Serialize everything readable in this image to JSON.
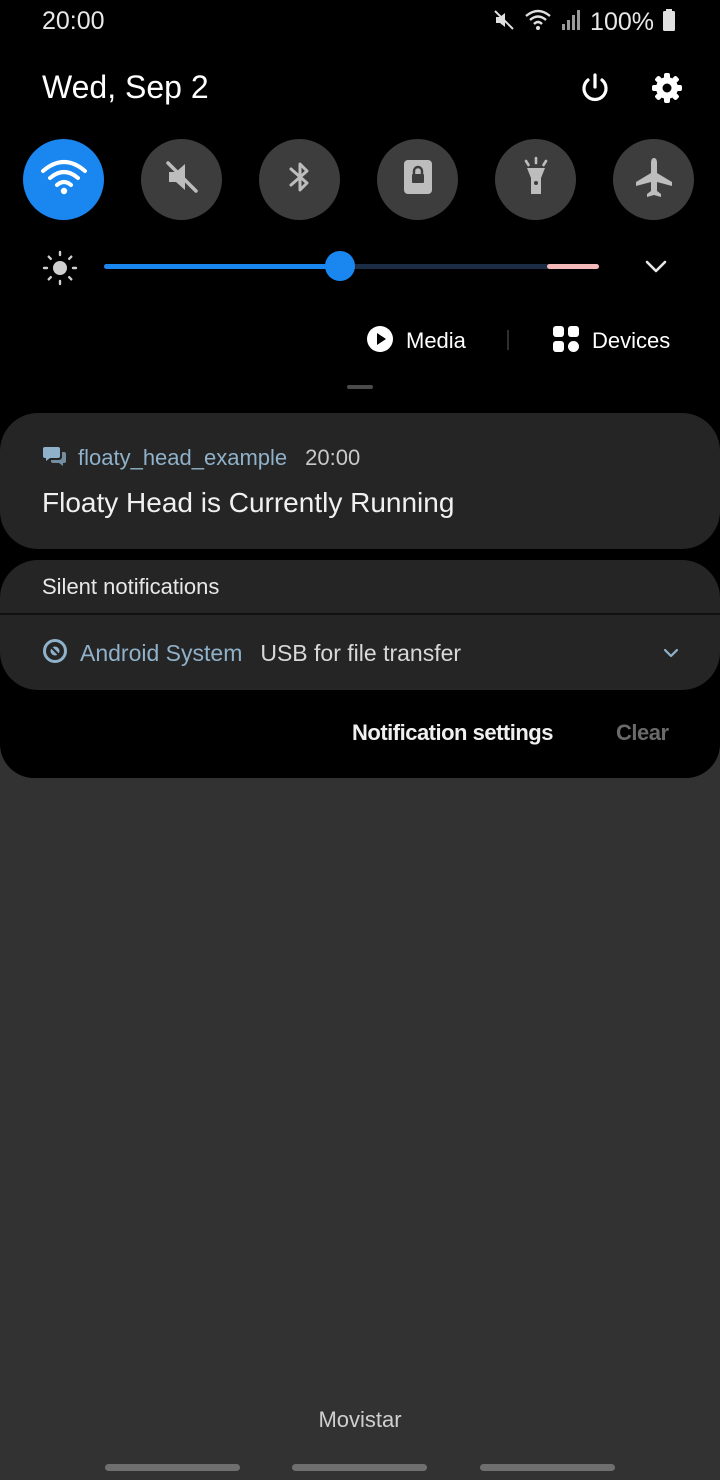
{
  "status_bar": {
    "time": "20:00",
    "battery_percent": "100%",
    "icons": [
      "mute-icon",
      "wifi-icon",
      "signal-icon",
      "battery-icon"
    ]
  },
  "header": {
    "date": "Wed, Sep 2",
    "icons": [
      "power-icon",
      "gear-icon"
    ]
  },
  "quick_toggles": [
    {
      "name": "wifi",
      "icon": "wifi-icon",
      "active": true
    },
    {
      "name": "sound",
      "icon": "mute-icon",
      "active": false
    },
    {
      "name": "bluetooth",
      "icon": "bluetooth-icon",
      "active": false
    },
    {
      "name": "portrait-lock",
      "icon": "lock-icon",
      "active": false
    },
    {
      "name": "flashlight",
      "icon": "flashlight-icon",
      "active": false
    },
    {
      "name": "airplane",
      "icon": "airplane-icon",
      "active": false
    }
  ],
  "brightness": {
    "level": 0.476,
    "icon": "brightness-icon"
  },
  "media_row": {
    "media_label": "Media",
    "devices_label": "Devices"
  },
  "notifications": [
    {
      "app_name": "floaty_head_example",
      "time": "20:00",
      "title": "Floaty Head is Currently Running",
      "icon": "chat-icon"
    }
  ],
  "silent": {
    "header": "Silent notifications",
    "items": [
      {
        "app_name": "Android System",
        "text": "USB for file transfer",
        "icon": "android-system-icon"
      }
    ]
  },
  "actions": {
    "notification_settings": "Notification settings",
    "clear": "Clear"
  },
  "carrier": "Movistar",
  "colors": {
    "accent": "#1a86f0",
    "panel_bg": "#000000",
    "card_bg": "#252525",
    "screen_bg": "#323232",
    "app_name": "#8fb1c9"
  }
}
